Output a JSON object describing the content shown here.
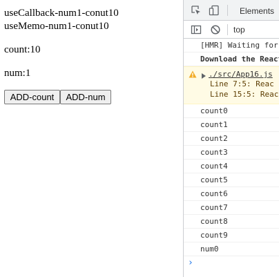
{
  "app": {
    "line1": "useCallback-num1-conut10",
    "line2": "useMemo-num1-conut10",
    "count_text": "count:10",
    "num_text": "num:1",
    "add_count_label": "ADD-count",
    "add_num_label": "ADD-num"
  },
  "devtools": {
    "tabs": {
      "elements": "Elements"
    },
    "toolbar": {
      "context": "top"
    },
    "icons": [
      "inspect-icon",
      "device-toggle-icon",
      "sidebar-toggle-icon",
      "clear-console-icon",
      "warning-icon",
      "expand-arrow-icon",
      "prompt-chevron-icon"
    ],
    "colors": {
      "warning_bg": "#fffbe5",
      "warning_icon": "#f2ab26",
      "prompt": "#1a73e8"
    },
    "console": {
      "hmr": "[HMR] Waiting for",
      "download": "Download the React",
      "warning": {
        "source": "./src/App16.js",
        "line1": "Line 7:5:   Reac",
        "line2": "Line 15:5:  Reac"
      },
      "logs": [
        "count0",
        "count1",
        "count2",
        "count3",
        "count4",
        "count5",
        "count6",
        "count7",
        "count8",
        "count9",
        "num0"
      ]
    }
  }
}
